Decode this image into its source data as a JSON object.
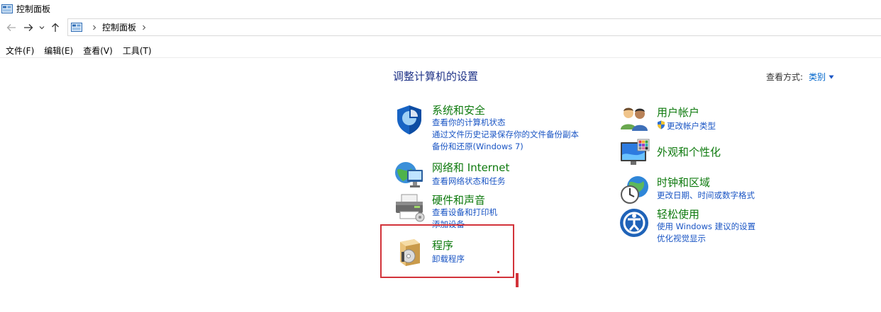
{
  "window": {
    "title": "控制面板",
    "icon": "control-panel-icon"
  },
  "nav": {
    "back_icon": "back-arrow-icon",
    "forward_icon": "forward-arrow-icon",
    "recent_icon": "chevron-down-icon",
    "up_icon": "up-arrow-icon",
    "breadcrumb": [
      "控制面板"
    ]
  },
  "menu": [
    "文件(F)",
    "编辑(E)",
    "查看(V)",
    "工具(T)"
  ],
  "main": {
    "heading": "调整计算机的设置",
    "view_by": {
      "label": "查看方式:",
      "value": "类别"
    }
  },
  "categories": {
    "system": {
      "title": "系统和安全",
      "links": [
        "查看你的计算机状态",
        "通过文件历史记录保存你的文件备份副本",
        "备份和还原(Windows 7)"
      ],
      "icon": "shield-icon"
    },
    "network": {
      "title": "网络和 Internet",
      "links": [
        "查看网络状态和任务"
      ],
      "icon": "globe-network-icon"
    },
    "hardware": {
      "title": "硬件和声音",
      "links": [
        "查看设备和打印机",
        "添加设备"
      ],
      "icon": "printer-icon"
    },
    "programs": {
      "title": "程序",
      "links": [
        "卸载程序"
      ],
      "icon": "programs-box-icon"
    },
    "users": {
      "title": "用户帐户",
      "links": [
        "更改帐户类型"
      ],
      "icon": "users-icon",
      "link_icon": "uac-shield-icon"
    },
    "appearance": {
      "title": "外观和个性化",
      "links": [],
      "icon": "monitor-icon"
    },
    "clock": {
      "title": "时钟和区域",
      "links": [
        "更改日期、时间或数字格式"
      ],
      "icon": "clock-globe-icon"
    },
    "ease": {
      "title": "轻松使用",
      "links": [
        "使用 Windows 建议的设置",
        "优化视觉显示"
      ],
      "icon": "ease-of-access-icon"
    }
  },
  "colors": {
    "category_title": "#0e7a0e",
    "link": "#1a55c4",
    "heading": "#1e3287",
    "annotation": "#d2333a"
  }
}
